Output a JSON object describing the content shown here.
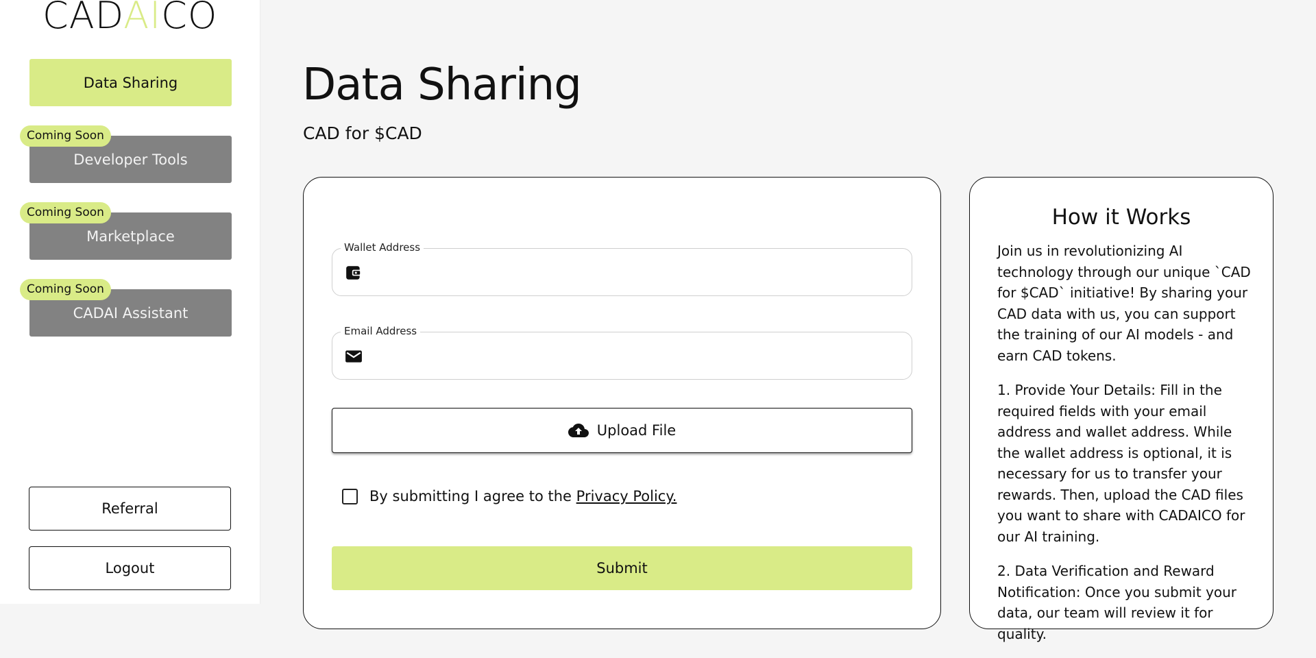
{
  "logo": {
    "part1": "CAD",
    "part2": "AI",
    "part3": "CO"
  },
  "sidebar": {
    "active_item": "Data Sharing",
    "badge": "Coming Soon",
    "disabled_items": [
      "Developer Tools",
      "Marketplace",
      "CADAI Assistant"
    ],
    "referral": "Referral",
    "logout": "Logout"
  },
  "main": {
    "title": "Data Sharing",
    "subtitle": "CAD for $CAD"
  },
  "form": {
    "wallet_label": "Wallet Address",
    "wallet_value": "",
    "email_label": "Email Address",
    "email_value": "",
    "upload_label": "Upload File",
    "consent_text": "By submitting I agree to the",
    "privacy_link": "Privacy Policy.",
    "submit_label": "Submit"
  },
  "info": {
    "title": "How it Works",
    "paragraphs": [
      "Join us in revolutionizing AI technology through our unique `CAD for $CAD` initiative! By sharing your CAD data with us, you can support the training of our AI models - and earn CAD tokens.",
      "1. Provide Your Details: Fill in the required fields with your email address and wallet address. While the wallet address is optional, it is necessary for us to transfer your rewards. Then, upload the CAD files you want to share with CADAICO for our AI training.",
      "2. Data Verification and Reward Notification: Once you submit your data, our team will review it for quality."
    ]
  },
  "colors": {
    "accent": "#d9eb87",
    "disabled": "#828282",
    "border": "#111111"
  },
  "icons": {
    "wallet": "wallet-icon",
    "email": "mail-icon",
    "upload": "cloud-upload-icon"
  }
}
